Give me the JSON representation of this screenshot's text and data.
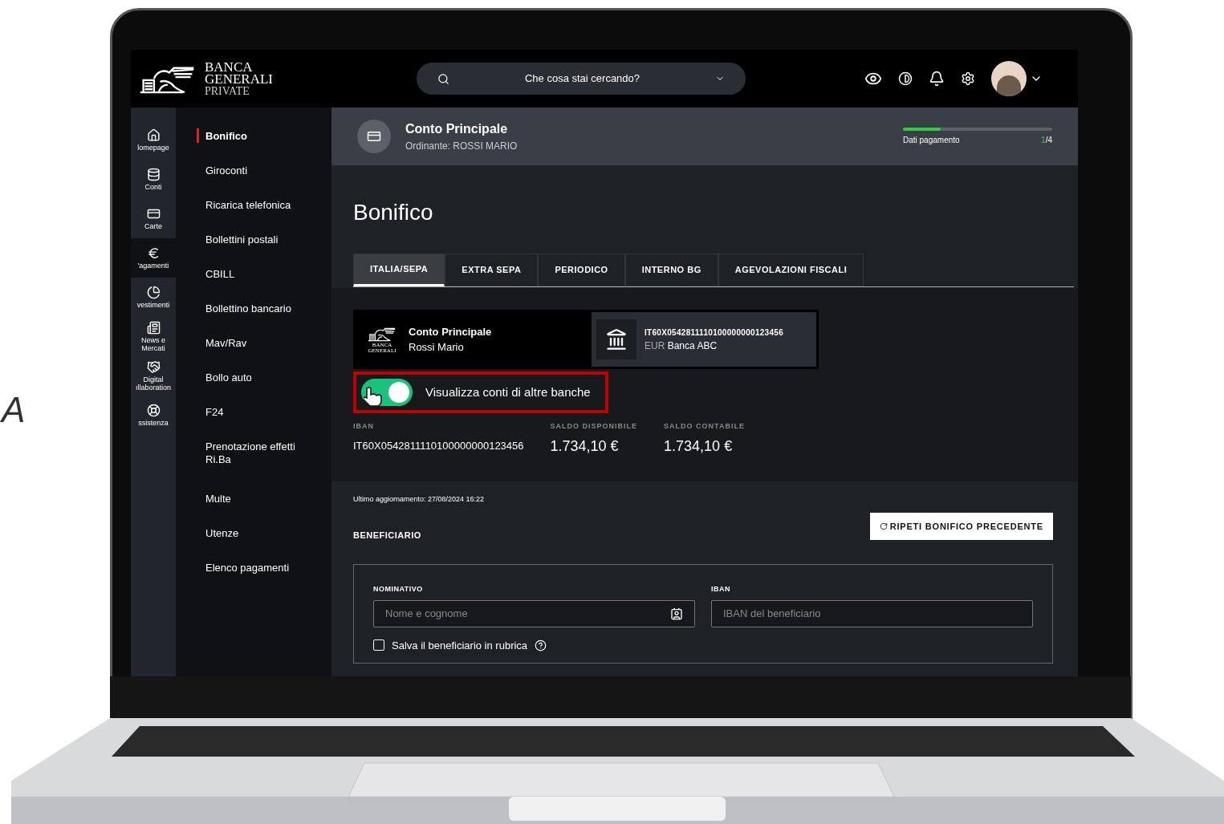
{
  "side_text": "A",
  "logo": {
    "lines": [
      "BANCA",
      "GENERALI",
      "PRIVATE"
    ]
  },
  "search": {
    "placeholder": "Che cosa stai cercando?"
  },
  "rail": [
    {
      "label": "lomepage",
      "selected": false
    },
    {
      "label": "Conti",
      "selected": false
    },
    {
      "label": "Carte",
      "selected": false
    },
    {
      "label": "'agamenti",
      "selected": true
    },
    {
      "label": "vestimenti",
      "selected": false
    },
    {
      "label": "News e Mercati",
      "selected": false
    },
    {
      "label": "Digital ıllaboration",
      "selected": false
    },
    {
      "label": "ssistenza",
      "selected": false
    }
  ],
  "menu": [
    {
      "label": "Bonifico",
      "selected": true
    },
    {
      "label": "Giroconti",
      "selected": false
    },
    {
      "label": "Ricarica telefonica",
      "selected": false
    },
    {
      "label": "Bollettini postali",
      "selected": false
    },
    {
      "label": "CBILL",
      "selected": false
    },
    {
      "label": "Bollettino bancario",
      "selected": false
    },
    {
      "label": "Mav/Rav",
      "selected": false
    },
    {
      "label": "Bollo auto",
      "selected": false
    },
    {
      "label": "F24",
      "selected": false
    },
    {
      "label": "Prenotazione effetti Ri.Ba",
      "selected": false
    },
    {
      "label": "Multe",
      "selected": false
    },
    {
      "label": "Utenze",
      "selected": false
    },
    {
      "label": "Elenco pagamenti",
      "selected": false
    }
  ],
  "header": {
    "title": "Conto Principale",
    "subtitle": "Ordinante: ROSSI MARIO",
    "progress_label": "Dati pagamento",
    "step_current": "1",
    "step_total": "/4",
    "level": 0.25
  },
  "title": "Bonifico",
  "tabs": [
    {
      "label": "ITALIA/SEPA",
      "selected": true
    },
    {
      "label": "EXTRA SEPA",
      "selected": false
    },
    {
      "label": "PERIODICO",
      "selected": false
    },
    {
      "label": "INTERNO BG",
      "selected": false
    },
    {
      "label": "AGEVOLAZIONI FISCALI",
      "selected": false
    }
  ],
  "account": {
    "logo_lines": [
      "BANCA",
      "GENERALI"
    ],
    "name": "Conto Principale",
    "holder": "Rossi Mario",
    "iban": "IT60X0542811110100000000123456",
    "currency": "EUR",
    "bank": "Banca ABC"
  },
  "toggle": {
    "label": "Visualizza conti di altre banche",
    "on": true
  },
  "balances": [
    {
      "label": "IBAN",
      "value": "IT60X0542811110100000000123456"
    },
    {
      "label": "SALDO DISPONIBILE",
      "value": "1.734,10 €"
    },
    {
      "label": "SALDO CONTABILE",
      "value": "1.734,10 €"
    }
  ],
  "updated": "Ultimo aggiornamento: 27/08/2024 16:22",
  "repeat_button": "RIPETI BONIFICO PRECEDENTE",
  "beneficiary": {
    "heading": "BENEFICIARIO",
    "name_label": "NOMINATIVO",
    "name_placeholder": "Nome e cognome",
    "iban_label": "IBAN",
    "iban_placeholder": "IBAN del beneficiario",
    "save_label": "Salva il beneficiario in rubrica",
    "save_checked": false
  }
}
